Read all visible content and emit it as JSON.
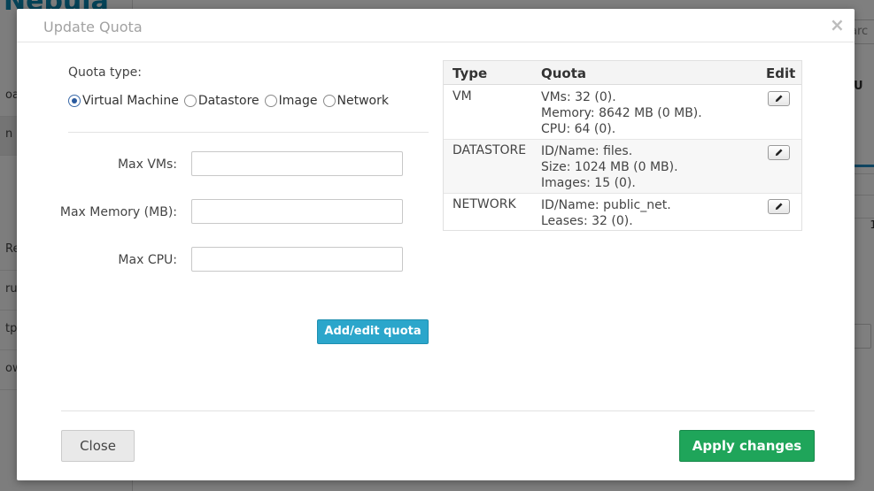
{
  "background": {
    "logo": "Nebula",
    "sidebar_items": [
      "oar",
      "n",
      "Re",
      "ruc",
      "tpla",
      "ow"
    ],
    "search_placeholder": "arc",
    "column_letter": "U",
    "cell_value": "1"
  },
  "modal": {
    "title": "Update Quota",
    "close_symbol": "×",
    "quota_type_label": "Quota type:",
    "quota_types": [
      {
        "label": "Virtual Machine",
        "checked": true
      },
      {
        "label": "Datastore",
        "checked": false
      },
      {
        "label": "Image",
        "checked": false
      },
      {
        "label": "Network",
        "checked": false
      }
    ],
    "fields": [
      {
        "label": "Max VMs:",
        "value": ""
      },
      {
        "label": "Max Memory (MB):",
        "value": ""
      },
      {
        "label": "Max CPU:",
        "value": ""
      }
    ],
    "add_edit_button": "Add/edit quota",
    "table": {
      "headers": {
        "type": "Type",
        "quota": "Quota",
        "edit": "Edit"
      },
      "rows": [
        {
          "type": "VM",
          "quota": [
            "VMs: 32 (0).",
            "Memory: 8642 MB (0 MB).",
            "CPU: 64 (0)."
          ]
        },
        {
          "type": "DATASTORE",
          "quota": [
            "ID/Name: files.",
            "Size: 1024 MB (0 MB).",
            "Images: 15 (0)."
          ]
        },
        {
          "type": "NETWORK",
          "quota": [
            "ID/Name: public_net.",
            "Leases: 32 (0)."
          ]
        }
      ]
    },
    "close_button": "Close",
    "apply_button": "Apply changes"
  },
  "colors": {
    "accent_blue": "#2ba6cb",
    "apply_green": "#1fa55a"
  }
}
